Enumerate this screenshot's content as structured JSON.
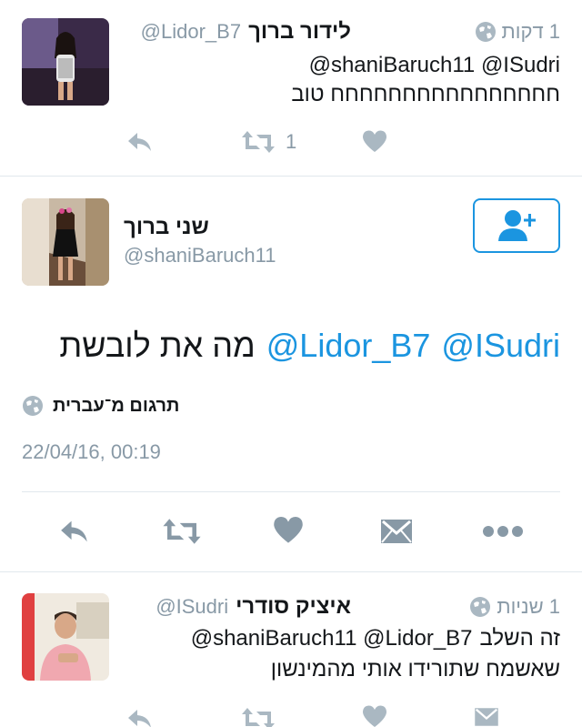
{
  "tweet1": {
    "display_name": "לידור ברוך",
    "handle": "@Lidor_B7",
    "time": "1 דקות",
    "line1": "@shaniBaruch11 @ISudri",
    "line2": "חחחחחחחחחחחחחחחח טוב",
    "retweet_count": "1"
  },
  "main_tweet": {
    "display_name": "שני ברוך",
    "handle": "@shaniBaruch11",
    "mention1": "@ISudri",
    "mention2": "@Lidor_B7",
    "text": "מה את לובשת",
    "translate_label": "תרגום מ־עברית",
    "timestamp": "22/04/16, 00:19"
  },
  "tweet3": {
    "display_name": "איציק סודרי",
    "handle": "@ISudri",
    "time": "1 שניות",
    "line1_text": "זה השלב",
    "line1_mentions": "@shaniBaruch11 @Lidor_B7",
    "line2": "שאשמח שתורידו אותי מהמינשון"
  },
  "icons": {
    "reply": "reply-icon",
    "retweet": "retweet-icon",
    "like": "heart-icon",
    "dm": "envelope-icon",
    "more": "more-icon",
    "globe": "globe-icon",
    "follow": "add-user-icon"
  },
  "colors": {
    "accent": "#1b95e0",
    "muted": "#8899a6",
    "icon": "#8899a6",
    "text": "#14171a"
  }
}
